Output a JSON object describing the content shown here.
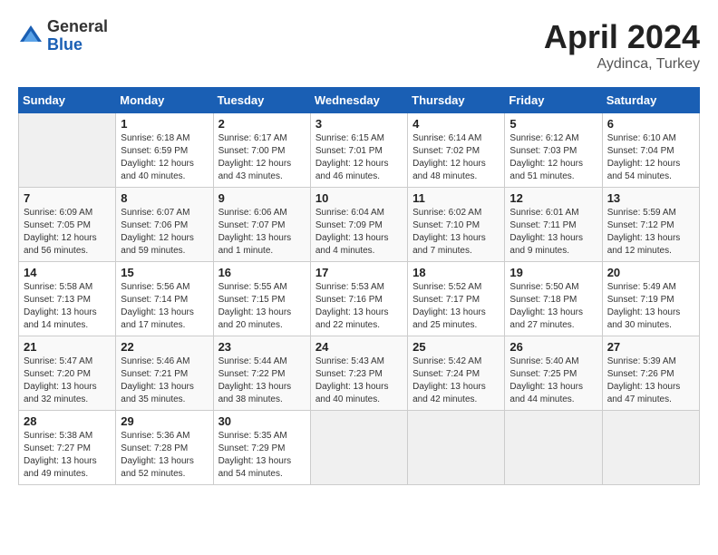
{
  "header": {
    "logo_general": "General",
    "logo_blue": "Blue",
    "month": "April 2024",
    "location": "Aydinca, Turkey"
  },
  "columns": [
    "Sunday",
    "Monday",
    "Tuesday",
    "Wednesday",
    "Thursday",
    "Friday",
    "Saturday"
  ],
  "weeks": [
    [
      {
        "day": "",
        "sunrise": "",
        "sunset": "",
        "daylight": ""
      },
      {
        "day": "1",
        "sunrise": "Sunrise: 6:18 AM",
        "sunset": "Sunset: 6:59 PM",
        "daylight": "Daylight: 12 hours and 40 minutes."
      },
      {
        "day": "2",
        "sunrise": "Sunrise: 6:17 AM",
        "sunset": "Sunset: 7:00 PM",
        "daylight": "Daylight: 12 hours and 43 minutes."
      },
      {
        "day": "3",
        "sunrise": "Sunrise: 6:15 AM",
        "sunset": "Sunset: 7:01 PM",
        "daylight": "Daylight: 12 hours and 46 minutes."
      },
      {
        "day": "4",
        "sunrise": "Sunrise: 6:14 AM",
        "sunset": "Sunset: 7:02 PM",
        "daylight": "Daylight: 12 hours and 48 minutes."
      },
      {
        "day": "5",
        "sunrise": "Sunrise: 6:12 AM",
        "sunset": "Sunset: 7:03 PM",
        "daylight": "Daylight: 12 hours and 51 minutes."
      },
      {
        "day": "6",
        "sunrise": "Sunrise: 6:10 AM",
        "sunset": "Sunset: 7:04 PM",
        "daylight": "Daylight: 12 hours and 54 minutes."
      }
    ],
    [
      {
        "day": "7",
        "sunrise": "Sunrise: 6:09 AM",
        "sunset": "Sunset: 7:05 PM",
        "daylight": "Daylight: 12 hours and 56 minutes."
      },
      {
        "day": "8",
        "sunrise": "Sunrise: 6:07 AM",
        "sunset": "Sunset: 7:06 PM",
        "daylight": "Daylight: 12 hours and 59 minutes."
      },
      {
        "day": "9",
        "sunrise": "Sunrise: 6:06 AM",
        "sunset": "Sunset: 7:07 PM",
        "daylight": "Daylight: 13 hours and 1 minute."
      },
      {
        "day": "10",
        "sunrise": "Sunrise: 6:04 AM",
        "sunset": "Sunset: 7:09 PM",
        "daylight": "Daylight: 13 hours and 4 minutes."
      },
      {
        "day": "11",
        "sunrise": "Sunrise: 6:02 AM",
        "sunset": "Sunset: 7:10 PM",
        "daylight": "Daylight: 13 hours and 7 minutes."
      },
      {
        "day": "12",
        "sunrise": "Sunrise: 6:01 AM",
        "sunset": "Sunset: 7:11 PM",
        "daylight": "Daylight: 13 hours and 9 minutes."
      },
      {
        "day": "13",
        "sunrise": "Sunrise: 5:59 AM",
        "sunset": "Sunset: 7:12 PM",
        "daylight": "Daylight: 13 hours and 12 minutes."
      }
    ],
    [
      {
        "day": "14",
        "sunrise": "Sunrise: 5:58 AM",
        "sunset": "Sunset: 7:13 PM",
        "daylight": "Daylight: 13 hours and 14 minutes."
      },
      {
        "day": "15",
        "sunrise": "Sunrise: 5:56 AM",
        "sunset": "Sunset: 7:14 PM",
        "daylight": "Daylight: 13 hours and 17 minutes."
      },
      {
        "day": "16",
        "sunrise": "Sunrise: 5:55 AM",
        "sunset": "Sunset: 7:15 PM",
        "daylight": "Daylight: 13 hours and 20 minutes."
      },
      {
        "day": "17",
        "sunrise": "Sunrise: 5:53 AM",
        "sunset": "Sunset: 7:16 PM",
        "daylight": "Daylight: 13 hours and 22 minutes."
      },
      {
        "day": "18",
        "sunrise": "Sunrise: 5:52 AM",
        "sunset": "Sunset: 7:17 PM",
        "daylight": "Daylight: 13 hours and 25 minutes."
      },
      {
        "day": "19",
        "sunrise": "Sunrise: 5:50 AM",
        "sunset": "Sunset: 7:18 PM",
        "daylight": "Daylight: 13 hours and 27 minutes."
      },
      {
        "day": "20",
        "sunrise": "Sunrise: 5:49 AM",
        "sunset": "Sunset: 7:19 PM",
        "daylight": "Daylight: 13 hours and 30 minutes."
      }
    ],
    [
      {
        "day": "21",
        "sunrise": "Sunrise: 5:47 AM",
        "sunset": "Sunset: 7:20 PM",
        "daylight": "Daylight: 13 hours and 32 minutes."
      },
      {
        "day": "22",
        "sunrise": "Sunrise: 5:46 AM",
        "sunset": "Sunset: 7:21 PM",
        "daylight": "Daylight: 13 hours and 35 minutes."
      },
      {
        "day": "23",
        "sunrise": "Sunrise: 5:44 AM",
        "sunset": "Sunset: 7:22 PM",
        "daylight": "Daylight: 13 hours and 38 minutes."
      },
      {
        "day": "24",
        "sunrise": "Sunrise: 5:43 AM",
        "sunset": "Sunset: 7:23 PM",
        "daylight": "Daylight: 13 hours and 40 minutes."
      },
      {
        "day": "25",
        "sunrise": "Sunrise: 5:42 AM",
        "sunset": "Sunset: 7:24 PM",
        "daylight": "Daylight: 13 hours and 42 minutes."
      },
      {
        "day": "26",
        "sunrise": "Sunrise: 5:40 AM",
        "sunset": "Sunset: 7:25 PM",
        "daylight": "Daylight: 13 hours and 44 minutes."
      },
      {
        "day": "27",
        "sunrise": "Sunrise: 5:39 AM",
        "sunset": "Sunset: 7:26 PM",
        "daylight": "Daylight: 13 hours and 47 minutes."
      }
    ],
    [
      {
        "day": "28",
        "sunrise": "Sunrise: 5:38 AM",
        "sunset": "Sunset: 7:27 PM",
        "daylight": "Daylight: 13 hours and 49 minutes."
      },
      {
        "day": "29",
        "sunrise": "Sunrise: 5:36 AM",
        "sunset": "Sunset: 7:28 PM",
        "daylight": "Daylight: 13 hours and 52 minutes."
      },
      {
        "day": "30",
        "sunrise": "Sunrise: 5:35 AM",
        "sunset": "Sunset: 7:29 PM",
        "daylight": "Daylight: 13 hours and 54 minutes."
      },
      {
        "day": "",
        "sunrise": "",
        "sunset": "",
        "daylight": ""
      },
      {
        "day": "",
        "sunrise": "",
        "sunset": "",
        "daylight": ""
      },
      {
        "day": "",
        "sunrise": "",
        "sunset": "",
        "daylight": ""
      },
      {
        "day": "",
        "sunrise": "",
        "sunset": "",
        "daylight": ""
      }
    ]
  ]
}
